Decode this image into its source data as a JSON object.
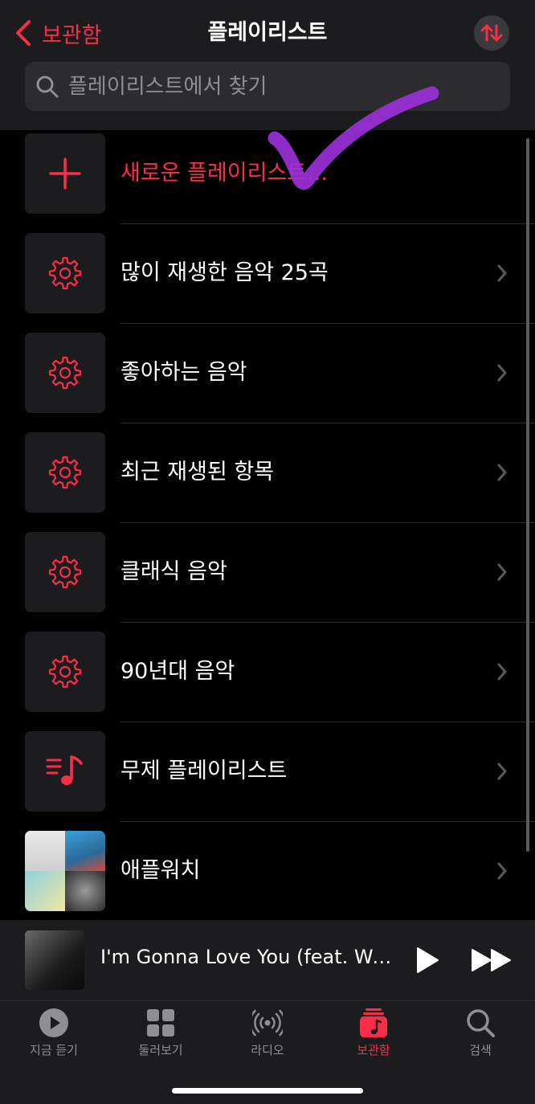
{
  "header": {
    "back_label": "보관함",
    "title": "플레이리스트"
  },
  "search": {
    "placeholder": "플레이리스트에서 찾기"
  },
  "playlists": [
    {
      "label": "새로운 플레이리스트...",
      "icon": "plus-icon"
    },
    {
      "label": "많이 재생한 음악 25곡",
      "icon": "gear-icon"
    },
    {
      "label": "좋아하는 음악",
      "icon": "gear-icon"
    },
    {
      "label": "최근 재생된 항목",
      "icon": "gear-icon"
    },
    {
      "label": "클래식 음악",
      "icon": "gear-icon"
    },
    {
      "label": "90년대 음악",
      "icon": "gear-icon"
    },
    {
      "label": "무제 플레이리스트",
      "icon": "music-list-icon"
    },
    {
      "label": "애플워치",
      "icon": "album-mosaic"
    }
  ],
  "now_playing": {
    "title": "I'm Gonna Love You (feat. Wo..."
  },
  "tabs": [
    {
      "label": "지금 듣기",
      "icon": "play-circle-icon"
    },
    {
      "label": "둘러보기",
      "icon": "grid-icon"
    },
    {
      "label": "라디오",
      "icon": "radio-icon"
    },
    {
      "label": "보관함",
      "icon": "library-icon",
      "active": true
    },
    {
      "label": "검색",
      "icon": "search-icon"
    }
  ],
  "colors": {
    "accent": "#fa2d48",
    "background": "#000000",
    "surface": "#1c1c1e",
    "annotation": "#9b30d9"
  }
}
